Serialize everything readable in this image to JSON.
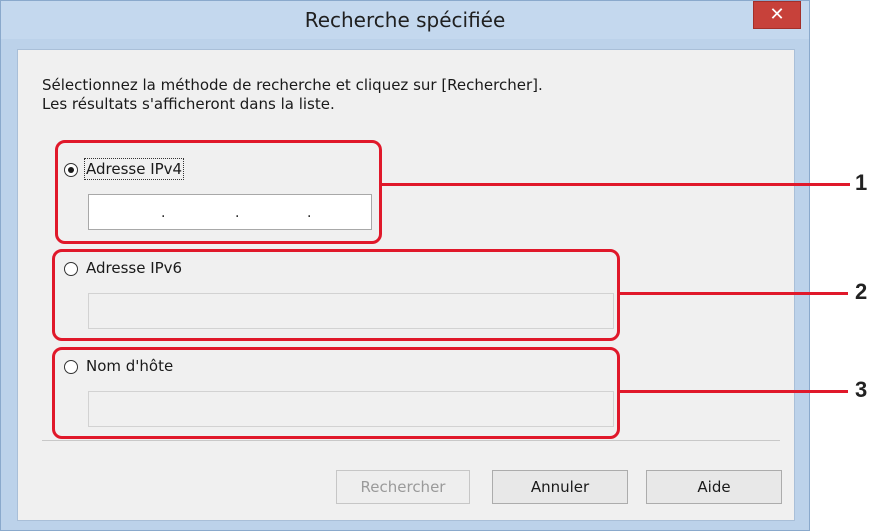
{
  "window": {
    "title": "Recherche spécifiée",
    "close_glyph": "✕"
  },
  "instruction": "Sélectionnez la méthode de recherche et cliquez sur [Rechercher].\nLes résultats s'afficheront dans la liste.",
  "options": [
    {
      "label": "Adresse IPv4",
      "selected": true,
      "field_enabled": true,
      "field_value": ". . ."
    },
    {
      "label": "Adresse IPv6",
      "selected": false,
      "field_enabled": false,
      "field_value": ""
    },
    {
      "label": "Nom d'hôte",
      "selected": false,
      "field_enabled": false,
      "field_value": ""
    }
  ],
  "callouts": [
    "1",
    "2",
    "3"
  ],
  "buttons": {
    "search": "Rechercher",
    "cancel": "Annuler",
    "help": "Aide"
  },
  "colors": {
    "callout": "#e0182a",
    "close_button": "#c7413a",
    "titlebar": "#c4d8ee"
  }
}
